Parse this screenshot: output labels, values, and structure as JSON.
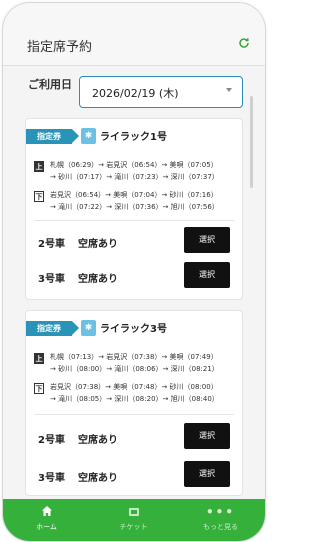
{
  "header": {
    "title": "指定席予約",
    "refresh_icon": "refresh-icon"
  },
  "date": {
    "label": "ご利用日",
    "value": "2026/02/19 (木)"
  },
  "trains": [
    {
      "badge": "指定券",
      "name": "ライラック1号",
      "routes": [
        {
          "kind": "上",
          "line1": "札幌（06:29）→ 岩見沢（06:54）→ 美唄（07:05）",
          "line2": "→ 砂川（07:17）→ 滝川（07:23）→ 深川（07:37）"
        },
        {
          "kind": "下",
          "line1": "岩見沢（06:54）→ 美唄（07:04）→ 砂川（07:16）",
          "line2": "→ 滝川（07:22）→ 深川（07:36）→ 旭川（07:56）"
        }
      ],
      "cars": [
        {
          "car": "2号車",
          "status": "空席あり",
          "button": "選択"
        },
        {
          "car": "3号車",
          "status": "空席あり",
          "button": "選択"
        }
      ]
    },
    {
      "badge": "指定券",
      "name": "ライラック3号",
      "routes": [
        {
          "kind": "上",
          "line1": "札幌（07:13）→ 岩見沢（07:38）→ 美唄（07:49）",
          "line2": "→ 砂川（08:00）→ 滝川（08:06）→ 深川（08:21）"
        },
        {
          "kind": "下",
          "line1": "岩見沢（07:38）→ 美唄（07:48）→ 砂川（08:00）",
          "line2": "→ 滝川（08:05）→ 深川（08:20）→ 旭川（08:40）"
        }
      ],
      "cars": [
        {
          "car": "2号車",
          "status": "空席あり",
          "button": "選択"
        },
        {
          "car": "3号車",
          "status": "空席あり",
          "button": "選択"
        }
      ]
    }
  ],
  "tabs": [
    {
      "label": "ホーム",
      "icon": "home-icon"
    },
    {
      "label": "チケット",
      "icon": "ticket-icon"
    },
    {
      "label": "もっと見る",
      "icon": "more-icon"
    }
  ],
  "colors": {
    "accent": "#35b13b",
    "badge": "#2a93b8",
    "select_border": "#2b8fb3"
  }
}
